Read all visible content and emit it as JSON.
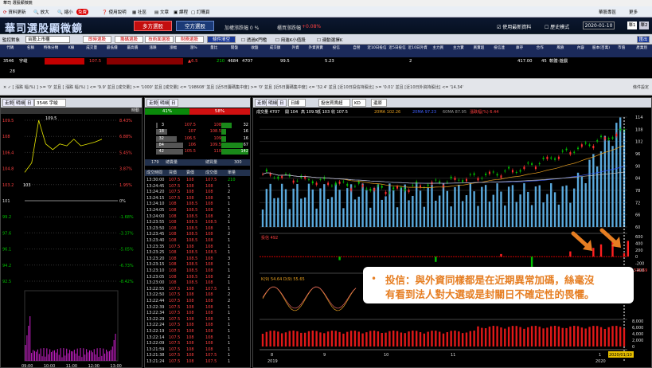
{
  "window": {
    "title": "華司 選股顯微鏡"
  },
  "toolbar": {
    "items": [
      "資料更新",
      "放大",
      "縮小",
      "免費",
      "使用說明",
      "社區",
      "文章",
      "課程",
      "訂購頁"
    ],
    "right": "華股專區",
    "more": "更多"
  },
  "banner": {
    "logo": "華司選股顯微鏡",
    "long_btn": "多方選股",
    "short_btn": "空方選股",
    "added_count": "加權漲跌幅 0 %",
    "index_label": "櫃買漲跌幅",
    "index_value": "+0.08%",
    "check_latest": "使用最新資料",
    "check_history": "歷史模式",
    "date": "2020-01-10",
    "tab1": "單1",
    "tab2": "單2"
  },
  "filters": {
    "label": "監控對象",
    "select": "台股上市櫃",
    "tags": [
      "即時選股",
      "籌碼選股",
      "技術面選股",
      "財務選股"
    ],
    "clear": "條件清空",
    "chk1": "透過K門檻",
    "chk2": "用進K小值股",
    "chk3": "連動選擇K",
    "export": "匯出"
  },
  "columns": [
    "代碼",
    "名稱",
    "特殊分類",
    "K線",
    "成交量",
    "最低價",
    "最高價",
    "漲跌",
    "漲幅",
    "漲%",
    "量比",
    "開盤",
    "收盤",
    "成交額",
    "外資",
    "外資買賣",
    "投信",
    "自營",
    "近10日投信",
    "近5日投信",
    "近10日外資",
    "主力買",
    "主力賣",
    "買賣超",
    "投信連",
    "庫存",
    "合作",
    "風險",
    "內容",
    "股本(百萬)",
    "市值",
    "產業別"
  ],
  "row": {
    "code": "3546",
    "name": "宇峻",
    "price1": "107.5",
    "price2": "109.5",
    "price3": "103.6",
    "chg": "▲6.5",
    "vol1": "210",
    "vol2": "4684",
    "vol3": "4707",
    "val": "99.5",
    "k": "5.23",
    "n": "2",
    "cap": "417.00",
    "pe": "45",
    "industry": "軟體-遊戲"
  },
  "row2": "28",
  "query": "✕ ✓  [ 漲跌  幅(%) ] >= '0' 並且 [ 漲跌 幅(%) ] <= '9.9' 並且 [成交量] >= '1000' 並且 [成交量] <= '198608' 並且 [近5日籌碼集中度] >= '0' 並且 [近5日籌碼集中度] <= '32.4' 並且 [近10日投信持股比] >= '0.01' 並且 [近10日外資持股比] <= '14.34'",
  "query_right": "條件設定",
  "left_panel": {
    "tabs": [
      "走勢",
      "明細",
      "日"
    ],
    "code": "3546 宇峻",
    "mode": "時動",
    "price_ticks": [
      "109.5",
      "108",
      "106.4",
      "104.8",
      "103.2",
      "101",
      "99.2",
      "97.6",
      "96.1",
      "94.2",
      "92.5"
    ],
    "pct_ticks": [
      "8.43%",
      "6.88%",
      "5.45%",
      "3.87%",
      "1.95%",
      "0%",
      "-1.68%",
      "-3.37%",
      "-5.05%",
      "-6.73%",
      "-8.42%"
    ],
    "high_label": "109.5",
    "low_label": "103",
    "times": [
      "09:00",
      "10:00",
      "11:00",
      "12:00",
      "13:00"
    ]
  },
  "mid_panel": {
    "tabs": [
      "走勢",
      "明細",
      "日"
    ],
    "buy_pct": "41%",
    "sell_pct": "58%",
    "book": [
      [
        "3",
        "107.5",
        "108",
        "32"
      ],
      [
        "18",
        "107",
        "108.5",
        "16"
      ],
      [
        "32",
        "106.5",
        "109",
        "16"
      ],
      [
        "84",
        "106",
        "109.5",
        "67"
      ],
      [
        "42",
        "105.5",
        "110",
        "142"
      ]
    ],
    "stats": [
      "179",
      "總賣量",
      "總買量",
      "300"
    ],
    "tick_cols": [
      "成交時間",
      "買價",
      "賣價",
      "成交價",
      "單量"
    ],
    "ticks": [
      [
        "13:30:00",
        "107.5",
        "108",
        "107.5",
        "210"
      ],
      [
        "13:24:45",
        "107.5",
        "108",
        "108",
        "1"
      ],
      [
        "13:24:20",
        "107.5",
        "108",
        "108",
        "2"
      ],
      [
        "13:24:15",
        "107.5",
        "108",
        "108",
        "5"
      ],
      [
        "13:24:10",
        "108",
        "108.5",
        "108",
        "1"
      ],
      [
        "13:24:05",
        "108",
        "108.5",
        "108",
        "1"
      ],
      [
        "13:24:00",
        "108",
        "108.5",
        "108",
        "2"
      ],
      [
        "13:23:55",
        "108",
        "108.5",
        "108.5",
        "1"
      ],
      [
        "13:23:50",
        "108",
        "108.5",
        "108",
        "1"
      ],
      [
        "13:23:45",
        "108",
        "108.5",
        "108",
        "2"
      ],
      [
        "13:23:40",
        "108",
        "108.5",
        "108",
        "1"
      ],
      [
        "13:23:35",
        "107.5",
        "108",
        "108",
        "1"
      ],
      [
        "13:23:25",
        "108",
        "108.5",
        "108.5",
        "1"
      ],
      [
        "13:23:20",
        "108",
        "108.5",
        "108",
        "3"
      ],
      [
        "13:23:15",
        "108",
        "108.5",
        "108",
        "1"
      ],
      [
        "13:23:10",
        "108",
        "108.5",
        "108",
        "1"
      ],
      [
        "13:23:05",
        "108",
        "108.5",
        "108",
        "2"
      ],
      [
        "13:23:00",
        "108",
        "108.5",
        "108",
        "1"
      ],
      [
        "13:22:55",
        "107.5",
        "108",
        "107.5",
        "1"
      ],
      [
        "13:22:50",
        "107.5",
        "108",
        "108",
        "2"
      ],
      [
        "13:22:44",
        "107.5",
        "108",
        "108",
        "2"
      ],
      [
        "13:22:39",
        "107.5",
        "108",
        "108",
        "1"
      ],
      [
        "13:22:34",
        "107.5",
        "108",
        "108",
        "1"
      ],
      [
        "13:22:29",
        "107.5",
        "108",
        "108",
        "1"
      ],
      [
        "13:22:24",
        "107.5",
        "108",
        "108",
        "1"
      ],
      [
        "13:22:19",
        "107.5",
        "108",
        "108",
        "1"
      ],
      [
        "13:22:14",
        "107.5",
        "108",
        "108",
        "1"
      ],
      [
        "13:22:09",
        "107.5",
        "108",
        "108",
        "1"
      ],
      [
        "13:21:59",
        "107.5",
        "108",
        "108",
        "1"
      ],
      [
        "13:21:38",
        "107.5",
        "108",
        "107.5",
        "1"
      ],
      [
        "13:21:24",
        "107.5",
        "108",
        "107.5",
        "1"
      ]
    ]
  },
  "right_panel": {
    "tabs": [
      "走勢",
      "明細",
      "日"
    ],
    "period": "日線",
    "indicator": "投信買賣超",
    "kd": "KD",
    "misc": "還原",
    "legend": {
      "vol": "成交量 4707",
      "o": "開 104",
      "h": "高 109.5",
      "l": "低 103",
      "c": "收 107.5",
      "ma20": "20MA 102.26",
      "ma60": "20MA 97.23",
      "ma120": "60MA 87.95",
      "qd": "漲跌幅(%) 6.44"
    },
    "price_ticks": [
      "114",
      "108",
      "102",
      "96",
      "90",
      "84",
      "78",
      "72",
      "66",
      "60"
    ],
    "sub1_label": "投信 492",
    "sub1_ticks": [
      "600",
      "400",
      "200",
      "0",
      "-200",
      "-400"
    ],
    "sub2_label": "K(9) 54.64   D(9) 55.65",
    "sub2_ticks": [
      "8,000",
      "6,000",
      "4,000",
      "2,000",
      "0"
    ],
    "months": [
      "8",
      "9",
      "10",
      "11",
      "1"
    ],
    "years": [
      "2019",
      "2020"
    ],
    "date_tag": "2020/01/10",
    "low_tag": "-316.69"
  },
  "callout": {
    "line1": "投信：與外資同樣都是在近期異常加碼，絲毫沒",
    "line2": "有看到法人對大選或是封關日不確定性的畏懼。"
  },
  "colors": {
    "up": "#ff3030",
    "down": "#00c000",
    "accent": "#e67e22"
  },
  "chart_data": [
    {
      "type": "line",
      "title": "3546 宇峻 intraday",
      "x": [
        "09:00",
        "09:15",
        "09:30",
        "09:45",
        "10:00",
        "10:30",
        "11:00",
        "11:30",
        "12:00",
        "12:30",
        "13:00",
        "13:30"
      ],
      "values": [
        104,
        105,
        109.5,
        107,
        106.4,
        107,
        106.8,
        107.5,
        106.8,
        107,
        107.2,
        107.5
      ],
      "ylim": [
        92.5,
        109.5
      ]
    },
    {
      "type": "line",
      "title": "K線 daily",
      "categories": [
        "8",
        "9",
        "10",
        "11",
        "1"
      ],
      "series": [
        {
          "name": "收",
          "values": [
            86,
            84,
            83,
            80,
            79,
            81,
            85,
            84,
            86,
            87,
            85,
            86,
            88,
            90,
            92,
            94,
            95,
            97,
            96,
            100,
            102,
            104,
            107.5
          ]
        },
        {
          "name": "20MA",
          "values": [
            86,
            86,
            85,
            84,
            83,
            82,
            82,
            83,
            84,
            85,
            85,
            86,
            86,
            87,
            88,
            89,
            90,
            91,
            92,
            94,
            96,
            99,
            102.26
          ]
        },
        {
          "name": "60MA",
          "values": [
            84,
            84,
            84,
            84,
            83,
            83,
            83,
            83,
            83,
            83,
            84,
            84,
            84,
            85,
            85,
            86,
            86,
            87,
            87,
            88,
            88,
            89,
            87.95
          ]
        }
      ],
      "ylim": [
        60,
        114
      ]
    },
    {
      "type": "bar",
      "title": "投信 492",
      "values": [
        0,
        0,
        0,
        0,
        0,
        0,
        0,
        0,
        0,
        -40,
        0,
        0,
        30,
        0,
        0,
        0,
        0,
        -150,
        0,
        0,
        200,
        350,
        492
      ],
      "ylim": [
        -400,
        600
      ]
    },
    {
      "type": "bar",
      "title": "成交量",
      "values": [
        2,
        3,
        2,
        2,
        3,
        2,
        4,
        3,
        2,
        2,
        3,
        2,
        3,
        3,
        4,
        3,
        5,
        4,
        8,
        6,
        11,
        9,
        10
      ],
      "ylim": [
        0,
        12
      ]
    }
  ]
}
